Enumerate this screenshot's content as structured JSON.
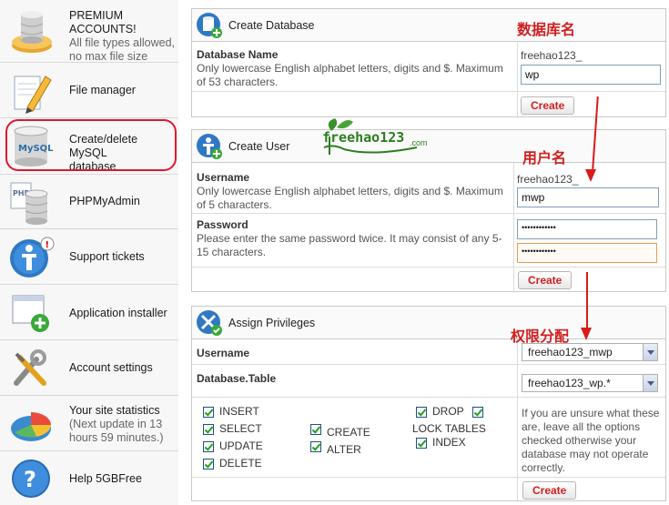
{
  "sidebar": {
    "items": [
      {
        "name": "sidebar-item-premium",
        "lines": [
          "PREMIUM",
          "ACCOUNTS!"
        ],
        "sub": [
          "All file types allowed,",
          "no max file size"
        ],
        "icon": "database-coin-icon"
      },
      {
        "name": "sidebar-item-file-manager",
        "label": "File manager",
        "icon": "file-pen-icon"
      },
      {
        "name": "sidebar-item-mysql",
        "lines": [
          "Create/delete MySQL",
          "database"
        ],
        "icon": "mysql-database-icon"
      },
      {
        "name": "sidebar-item-phpmyadmin",
        "label": "PHPMyAdmin",
        "icon": "php-database-icon"
      },
      {
        "name": "sidebar-item-support",
        "label": "Support tickets",
        "icon": "support-person-icon"
      },
      {
        "name": "sidebar-item-installer",
        "label": "Application installer",
        "icon": "app-window-plus-icon"
      },
      {
        "name": "sidebar-item-account-settings",
        "label": "Account settings",
        "icon": "tools-icon"
      },
      {
        "name": "sidebar-item-statistics",
        "lines": [
          "Your site statistics"
        ],
        "sub": [
          "(Next update in 13",
          "hours 59 minutes.)"
        ],
        "icon": "pie-chart-icon"
      },
      {
        "name": "sidebar-item-help",
        "label": "Help 5GBFree",
        "icon": "help-bubble-icon"
      }
    ]
  },
  "create_database": {
    "title": "Create Database",
    "label": "Database Name",
    "desc": [
      "Only lowercase English alphabet letters, digits and $. Maximum",
      "of 53 characters."
    ],
    "prefix": "freehao123_",
    "value": "wp",
    "button": "Create",
    "annotation": "数据库名"
  },
  "create_user": {
    "title": "Create User",
    "username_label": "Username",
    "username_desc": [
      "Only lowercase English alphabet letters, digits and $. Maximum",
      "of 5 characters."
    ],
    "prefix": "freehao123_",
    "username_value": "mwp",
    "password_label": "Password",
    "password_desc": [
      "Please enter the same password twice. It may consist of any 5-",
      "15 characters."
    ],
    "password_mask": "••••••••••••",
    "password_confirm_mask": "••••••••••••",
    "button": "Create",
    "annotation": "用户名"
  },
  "watermark": {
    "text": "freehao123",
    "suffix": ".com"
  },
  "assign_privileges": {
    "title": "Assign Privileges",
    "username_label": "Username",
    "username_value": "freehao123_mwp",
    "table_label": "Database.Table",
    "table_value": "freehao123_wp.*",
    "privileges": {
      "insert": "INSERT",
      "select": "SELECT",
      "update": "UPDATE",
      "delete": "DELETE",
      "create": "CREATE",
      "alter": "ALTER",
      "drop": "DROP",
      "lock_tables": "LOCK TABLES",
      "index": "INDEX"
    },
    "note": [
      "If you are unsure what these",
      "are, leave all the options",
      "checked otherwise your",
      "database may not operate",
      "correctly."
    ],
    "button": "Create",
    "annotation": "权限分配"
  },
  "colors": {
    "accent": "#d21f1f",
    "highlight_ring": "#e0182d",
    "panel_border": "#c9c9c9",
    "watermark_green": "#2e7d1e"
  }
}
